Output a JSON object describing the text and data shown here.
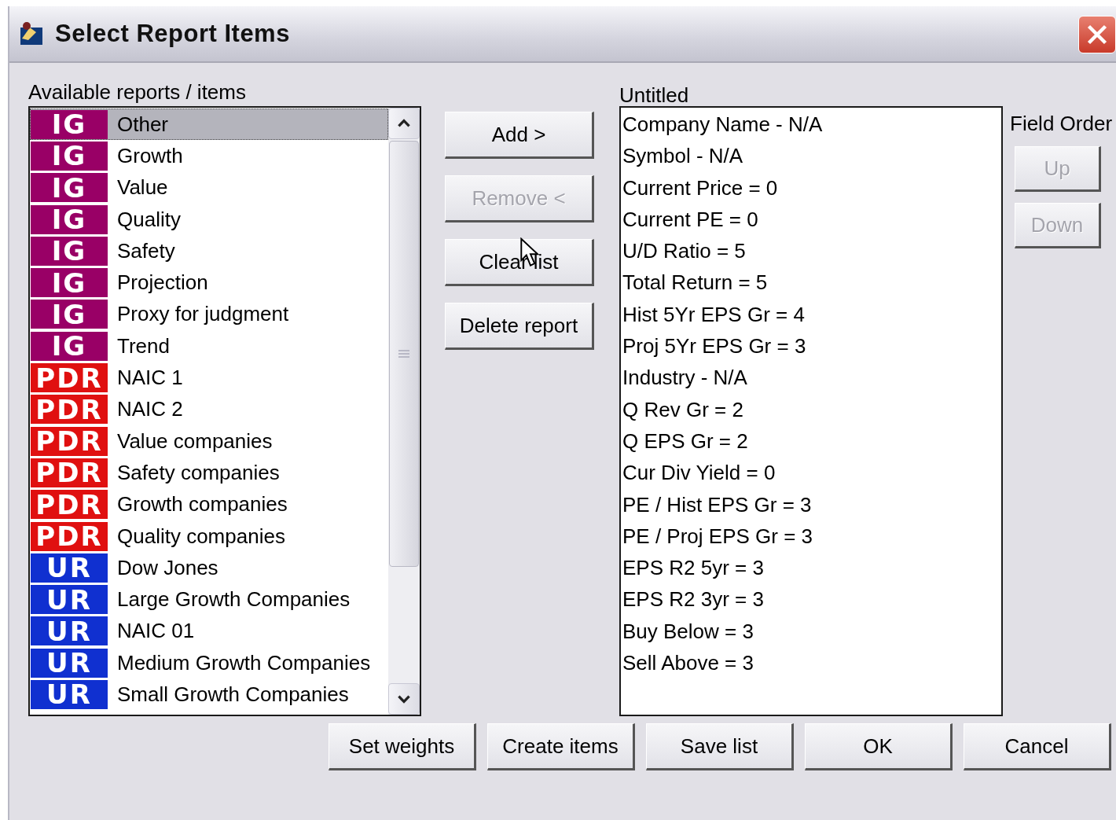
{
  "window": {
    "title": "Select Report Items"
  },
  "available": {
    "label": "Available reports / items",
    "items": [
      {
        "badge": "IG",
        "color": "#990066",
        "label": "Other",
        "selected": true
      },
      {
        "badge": "IG",
        "color": "#990066",
        "label": "Growth",
        "selected": false
      },
      {
        "badge": "IG",
        "color": "#990066",
        "label": "Value",
        "selected": false
      },
      {
        "badge": "IG",
        "color": "#990066",
        "label": "Quality",
        "selected": false
      },
      {
        "badge": "IG",
        "color": "#990066",
        "label": "Safety",
        "selected": false
      },
      {
        "badge": "IG",
        "color": "#990066",
        "label": "Projection",
        "selected": false
      },
      {
        "badge": "IG",
        "color": "#990066",
        "label": "Proxy for judgment",
        "selected": false
      },
      {
        "badge": "IG",
        "color": "#990066",
        "label": "Trend",
        "selected": false
      },
      {
        "badge": "PDR",
        "color": "#e01010",
        "label": "NAIC 1",
        "selected": false
      },
      {
        "badge": "PDR",
        "color": "#e01010",
        "label": "NAIC 2",
        "selected": false
      },
      {
        "badge": "PDR",
        "color": "#e01010",
        "label": "Value companies",
        "selected": false
      },
      {
        "badge": "PDR",
        "color": "#e01010",
        "label": "Safety companies",
        "selected": false
      },
      {
        "badge": "PDR",
        "color": "#e01010",
        "label": "Growth companies",
        "selected": false
      },
      {
        "badge": "PDR",
        "color": "#e01010",
        "label": "Quality companies",
        "selected": false
      },
      {
        "badge": "UR",
        "color": "#1030d0",
        "label": "Dow Jones",
        "selected": false
      },
      {
        "badge": "UR",
        "color": "#1030d0",
        "label": "Large Growth Companies",
        "selected": false
      },
      {
        "badge": "UR",
        "color": "#1030d0",
        "label": "NAIC 01",
        "selected": false
      },
      {
        "badge": "UR",
        "color": "#1030d0",
        "label": "Medium Growth Companies",
        "selected": false
      },
      {
        "badge": "UR",
        "color": "#1030d0",
        "label": "Small Growth Companies",
        "selected": false
      }
    ]
  },
  "middle_buttons": [
    {
      "label": "Add >",
      "disabled": false
    },
    {
      "label": "Remove <",
      "disabled": true
    },
    {
      "label": "Clear list",
      "disabled": false
    },
    {
      "label": "Delete report",
      "disabled": false
    }
  ],
  "selected_list": {
    "label": "Untitled",
    "items": [
      "Company Name - N/A",
      "Symbol - N/A",
      "Current Price = 0",
      "Current PE = 0",
      "U/D Ratio = 5",
      "Total Return = 5",
      "Hist 5Yr EPS Gr = 4",
      "Proj 5Yr EPS Gr = 3",
      "Industry - N/A",
      "Q Rev Gr = 2",
      "Q EPS Gr = 2",
      "Cur Div Yield = 0",
      "PE / Hist EPS Gr = 3",
      "PE / Proj EPS Gr = 3",
      "EPS R2 5yr = 3",
      "EPS R2 3yr = 3",
      "Buy Below = 3",
      "Sell Above = 3"
    ]
  },
  "field_order": {
    "label": "Field Order",
    "buttons": [
      {
        "label": "Up",
        "disabled": true
      },
      {
        "label": "Down",
        "disabled": true
      }
    ]
  },
  "bottom_buttons": [
    "Set weights",
    "Create items",
    "Save list",
    "OK",
    "Cancel"
  ]
}
